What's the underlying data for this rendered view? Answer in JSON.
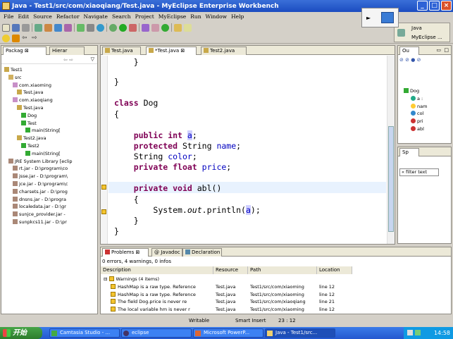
{
  "window": {
    "title": "Java - Test1/src/com/xiaoqiang/Test.java - MyEclipse Enterprise Workbench"
  },
  "menu": [
    "File",
    "Edit",
    "Source",
    "Refactor",
    "Navigate",
    "Search",
    "Project",
    "MyEclipse",
    "Run",
    "Window",
    "Help"
  ],
  "perspective": {
    "java": "Java",
    "myeclipse": "MyEclipse ..."
  },
  "left_view": {
    "tab_package": "Packag",
    "tab_hier": "Hierar",
    "tree": [
      "Test1",
      "src",
      "com.xiaoming",
      "Test.java",
      "com.xiaoqiang",
      "Test.java",
      "Dog",
      "Test",
      "main(String[",
      "Test2.java",
      "Test2",
      "main(String[",
      "JRE System Library [eclip",
      "rt.jar - D:\\program\\co",
      "jsse.jar - D:\\program\\",
      "jce.jar - D:\\program\\c",
      "charsets.jar - D:\\prog",
      "dnsns.jar - D:\\progra",
      "localedata.jar - D:\\gr",
      "sunjce_provider.jar -",
      "sunpkcs11.jar - D:\\pr"
    ]
  },
  "editor": {
    "tabs": [
      "Test.java",
      "*Test.java",
      "Test2.java"
    ],
    "lines": [
      "    }",
      "}",
      "class Dog",
      "{",
      "    public int a;",
      "    protected String name;",
      "    String color;",
      "    private float price;",
      "    private void abl()",
      "    {",
      "        System.out.println(a);",
      "    }",
      "}"
    ],
    "tokens": {
      "public": "public",
      "int": "int",
      "a": "a",
      "protected": "protected",
      "String": "String",
      "name": "name",
      "color": "color",
      "private": "private",
      "float": "float",
      "price": "price",
      "void": "void",
      "abl": "abl()",
      "system": "System.",
      "out": "out",
      "println": ".println(",
      "close": ");",
      "semi": ";",
      "classkw": "class",
      "dog": "Dog",
      "brace_open": "{",
      "brace_close": "}"
    }
  },
  "outline": {
    "tab": "Ou",
    "items": [
      "Dog",
      "a :",
      "nam",
      "col",
      "pri",
      "abl"
    ],
    "sp_tab": "Sp",
    "filter": "« filter text"
  },
  "problems": {
    "tabs": [
      "Problems",
      "Javadoc",
      "Declaration"
    ],
    "summary": "0 errors, 4 warnings, 0 infos",
    "columns": [
      "Description",
      "Resource",
      "Path",
      "Location"
    ],
    "group": "Warnings (4 items)",
    "rows": [
      [
        "HashMap is a raw type. Reference",
        "Test.java",
        "Test1/src/com/xiaoming",
        "line 12"
      ],
      [
        "HashMap is a raw type. Reference",
        "Test.java",
        "Test1/src/com/xiaoming",
        "line 12"
      ],
      [
        "The field Dog.price is never re",
        "Test.java",
        "Test1/src/com/xiaoqiang",
        "line 21"
      ],
      [
        "The local variable hm is never r",
        "Test.java",
        "Test1/src/com/xiaoming",
        "line 12"
      ]
    ]
  },
  "status": {
    "writable": "Writable",
    "insert": "Smart Insert",
    "position": "23 : 12"
  },
  "taskbar": {
    "start": "开始",
    "items": [
      "Camtasia Studio - ...",
      "eclipse",
      "Microsoft PowerP...",
      "Java - Test1/src..."
    ],
    "time": "14:58"
  },
  "colors": {
    "keyword": "#7f0055",
    "field": "#0000c0",
    "titlebar": "#1b4cc0",
    "taskbar": "#2458cf"
  }
}
